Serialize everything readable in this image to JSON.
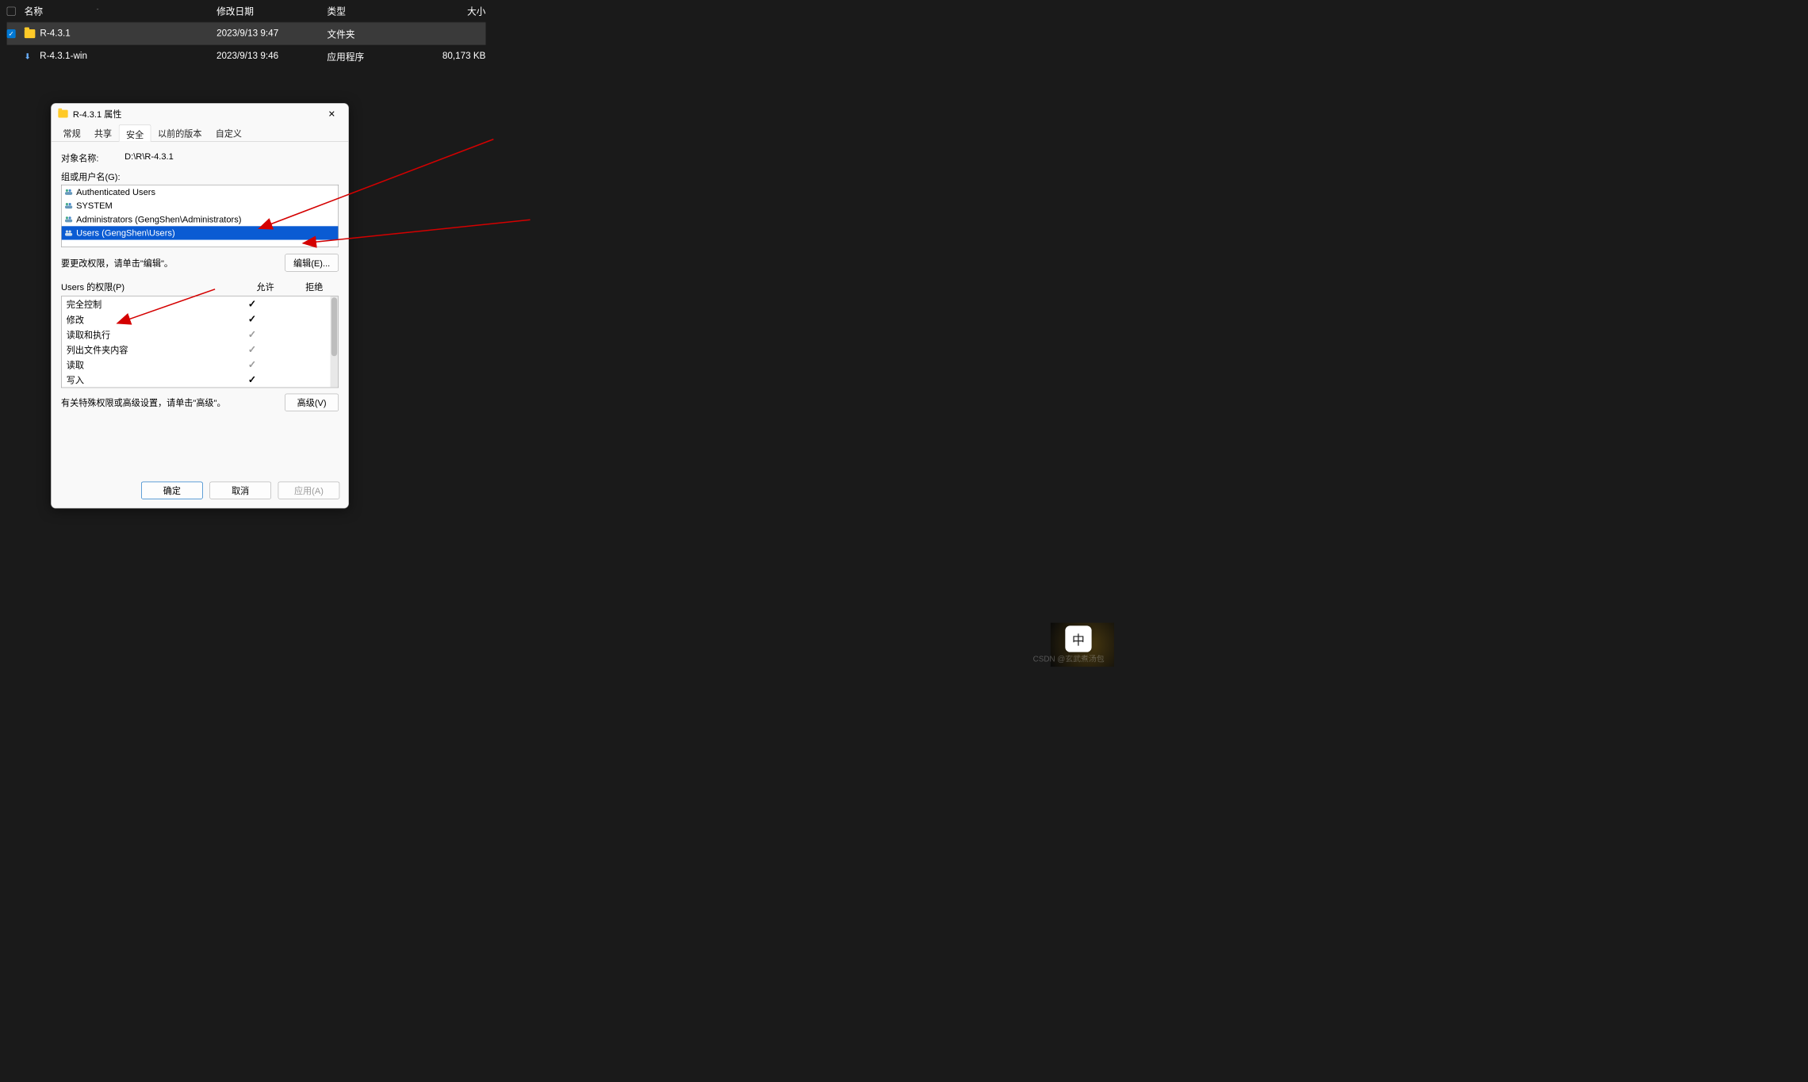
{
  "explorer": {
    "columns": {
      "name": "名称",
      "date": "修改日期",
      "type": "类型",
      "size": "大小"
    },
    "sort_indicator": "ˆ",
    "rows": [
      {
        "checked": true,
        "icon": "folder",
        "name": "R-4.3.1",
        "date": "2023/9/13 9:47",
        "type": "文件夹",
        "size": ""
      },
      {
        "checked": false,
        "icon": "app",
        "name": "R-4.3.1-win",
        "date": "2023/9/13 9:46",
        "type": "应用程序",
        "size": "80,173 KB"
      }
    ]
  },
  "dialog": {
    "title": "R-4.3.1 属性",
    "tabs": [
      "常规",
      "共享",
      "安全",
      "以前的版本",
      "自定义"
    ],
    "active_tab_index": 2,
    "object_label": "对象名称:",
    "object_value": "D:\\R\\R-4.3.1",
    "groups_label": "组或用户名(G):",
    "groups": [
      "Authenticated Users",
      "SYSTEM",
      "Administrators (GengShen\\Administrators)",
      "Users (GengShen\\Users)"
    ],
    "selected_group_index": 3,
    "edit_hint": "要更改权限，请单击\"编辑\"。",
    "edit_button": "编辑(E)...",
    "perm_list_label": "Users 的权限(P)",
    "allow_label": "允许",
    "deny_label": "拒绝",
    "permissions": [
      {
        "name": "完全控制",
        "allow": "black",
        "deny": ""
      },
      {
        "name": "修改",
        "allow": "black",
        "deny": ""
      },
      {
        "name": "读取和执行",
        "allow": "gray",
        "deny": ""
      },
      {
        "name": "列出文件夹内容",
        "allow": "gray",
        "deny": ""
      },
      {
        "name": "读取",
        "allow": "gray",
        "deny": ""
      },
      {
        "name": "写入",
        "allow": "black",
        "deny": ""
      }
    ],
    "advanced_hint": "有关特殊权限或高级设置，请单击\"高级\"。",
    "advanced_button": "高级(V)",
    "footer": {
      "ok": "确定",
      "cancel": "取消",
      "apply": "应用(A)"
    }
  },
  "ime": "中",
  "watermark": "CSDN @玄武煮汤包"
}
